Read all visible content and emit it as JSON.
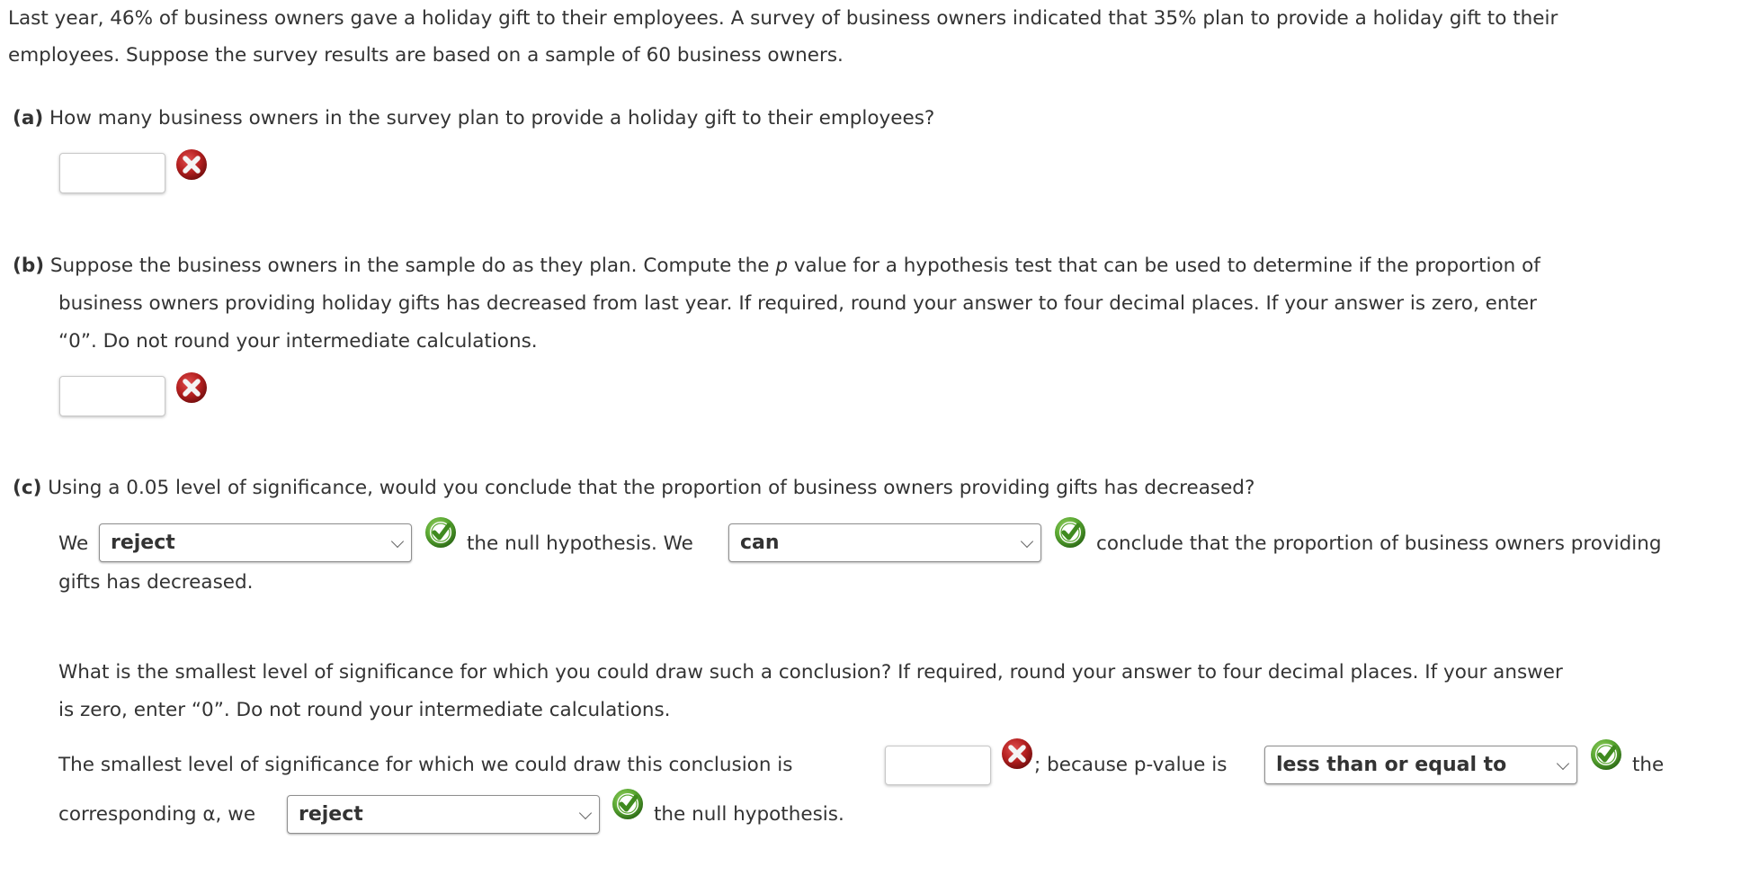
{
  "intro": {
    "line1": "Last year, 46% of business owners gave a holiday gift to their employees. A survey of business owners indicated that 35% plan to provide a holiday gift to their",
    "line2": "employees. Suppose the survey results are based on a sample of 60 business owners."
  },
  "part_a": {
    "label": "(a)",
    "question": "How many business owners in the survey plan to provide a holiday gift to their employees?",
    "answer_value": "",
    "status": "incorrect"
  },
  "part_b": {
    "label": "(b)",
    "line1_pre": "Suppose the business owners in the sample do as they plan. Compute the ",
    "line1_var": "p",
    "line1_post": " value for a hypothesis test that can be used to determine if the proportion of",
    "line2": "business owners providing holiday gifts has decreased from last year. If required, round your answer to four decimal places. If your answer is zero, enter",
    "line3": "“0”. Do not round your intermediate calculations.",
    "answer_value": "",
    "status": "incorrect"
  },
  "part_c": {
    "label": "(c)",
    "question": "Using a 0.05 level of significance, would you conclude that the proportion of business owners providing gifts has decreased?",
    "sentence": {
      "we": "We",
      "select1_value": "reject",
      "select1_status": "correct",
      "mid": "the null hypothesis. We",
      "select2_value": "can",
      "select2_status": "correct",
      "end": "conclude that the proportion of business owners providing",
      "wrap": "gifts has decreased."
    },
    "followup": {
      "line1": "What is the smallest level of significance for which you could draw such a conclusion? If required, round your answer to four decimal places. If your answer",
      "line2": "is zero, enter “0”. Do not round your intermediate calculations."
    },
    "conclusion": {
      "pre": "The smallest level of significance for which we could draw this conclusion is",
      "input_value": "",
      "input_status": "incorrect",
      "because": "; because p-value is",
      "select3_value": "less than or equal to",
      "select3_status": "correct",
      "the": "the",
      "corresponding": "corresponding α, we",
      "select4_value": "reject",
      "select4_status": "correct",
      "end": "the null hypothesis."
    }
  },
  "colors": {
    "text": "#333333",
    "incorrect": "#b52020",
    "correct": "#4a9a2a"
  }
}
